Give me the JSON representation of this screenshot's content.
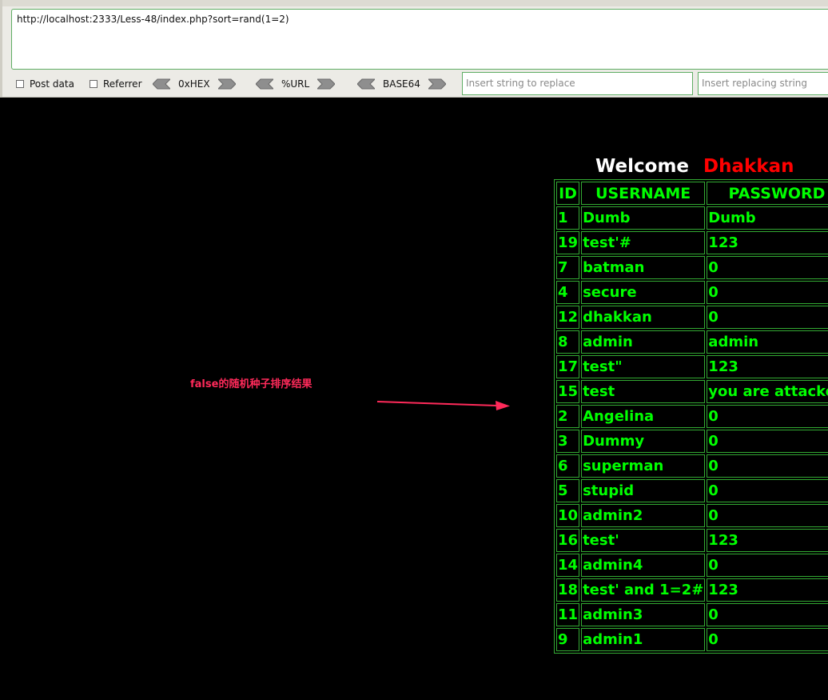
{
  "hackbar": {
    "url": "http://localhost:2333/Less-48/index.php?sort=rand(1=2)",
    "post_data_label": "Post data",
    "referrer_label": "Referrer",
    "hex_label": "0xHEX",
    "url_enc_label": "%URL",
    "base64_label": "BASE64",
    "replace_placeholder": "Insert string to replace",
    "replacing_placeholder": "Insert replacing string"
  },
  "page": {
    "welcome": "Welcome",
    "name": "Dhakkan",
    "annotation": "false的随机种子排序结果"
  },
  "table": {
    "headers": [
      "ID",
      "USERNAME",
      "PASSWORD"
    ],
    "rows": [
      [
        "1",
        "Dumb",
        "Dumb"
      ],
      [
        "19",
        "test'#",
        "123"
      ],
      [
        "7",
        "batman",
        "0"
      ],
      [
        "4",
        "secure",
        "0"
      ],
      [
        "12",
        "dhakkan",
        "0"
      ],
      [
        "8",
        "admin",
        "admin"
      ],
      [
        "17",
        "test\"",
        "123"
      ],
      [
        "15",
        "test",
        "you are attacked"
      ],
      [
        "2",
        "Angelina",
        "0"
      ],
      [
        "3",
        "Dummy",
        "0"
      ],
      [
        "6",
        "superman",
        "0"
      ],
      [
        "5",
        "stupid",
        "0"
      ],
      [
        "10",
        "admin2",
        "0"
      ],
      [
        "16",
        "test'",
        "123"
      ],
      [
        "14",
        "admin4",
        "0"
      ],
      [
        "18",
        "test' and 1=2#",
        "123"
      ],
      [
        "11",
        "admin3",
        "0"
      ],
      [
        "9",
        "admin1",
        "0"
      ]
    ]
  },
  "colors": {
    "background": "#000000",
    "table_text": "#00ff00",
    "table_border": "#33aa33",
    "welcome_text": "#ffffff",
    "name_text": "#ff0000",
    "annotation_text": "#ff2a5a"
  }
}
